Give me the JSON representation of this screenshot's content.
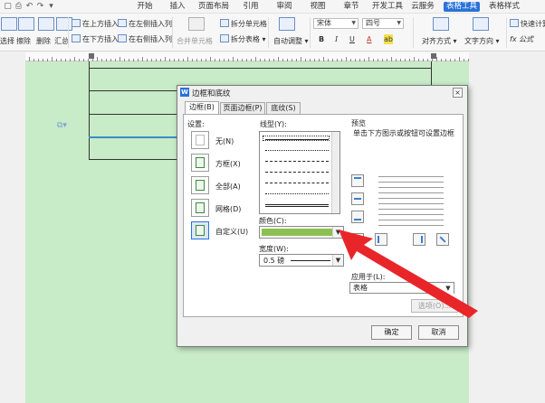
{
  "menubar": {
    "tabs": [
      "开始",
      "插入",
      "页面布局",
      "引用",
      "审阅",
      "视图",
      "章节",
      "开发工具",
      "云服务",
      "表格工具",
      "表格样式"
    ],
    "active_tab": "表格工具"
  },
  "toolbar": {
    "select_label": "选择",
    "erase_label": "擦除",
    "delete_label": "删除",
    "summary_label": "汇总",
    "insert_above": "在上方插入行",
    "insert_below": "在下方插入行",
    "insert_left": "在左侧插入列",
    "insert_right": "在右侧插入列",
    "merge_cells": "合并单元格",
    "split_cells": "拆分单元格",
    "split_table": "拆分表格",
    "autofit": "自动调整",
    "font_name": "宋体",
    "font_size": "四号",
    "bold": "B",
    "italic": "I",
    "underline": "U",
    "font_color": "A",
    "highlight": "ab",
    "align": "对齐方式",
    "text_direction": "文字方向",
    "quick_calc": "快速计算",
    "formula": "fx 公式"
  },
  "dialog": {
    "title": "边框和底纹",
    "close": "×",
    "tabs": [
      "边框(B)",
      "页面边框(P)",
      "底纹(S)"
    ],
    "settings_label": "设置:",
    "settings": [
      "无(N)",
      "方框(X)",
      "全部(A)",
      "网格(D)",
      "自定义(U)"
    ],
    "line_style_label": "线型(Y):",
    "color_label": "颜色(C):",
    "color_value": "#8cc152",
    "width_label": "宽度(W):",
    "width_value": "0.5  磅",
    "preview_label": "预览",
    "preview_hint": "单击下方图示或按钮可设置边框",
    "apply_to_label": "应用于(L):",
    "apply_to_value": "表格",
    "options_button": "选项(O)...",
    "ok_button": "确定",
    "cancel_button": "取消"
  },
  "colors": {
    "accent": "#2b72d9",
    "page_bg": "#c8ebc8",
    "arrow": "#e8262a"
  }
}
